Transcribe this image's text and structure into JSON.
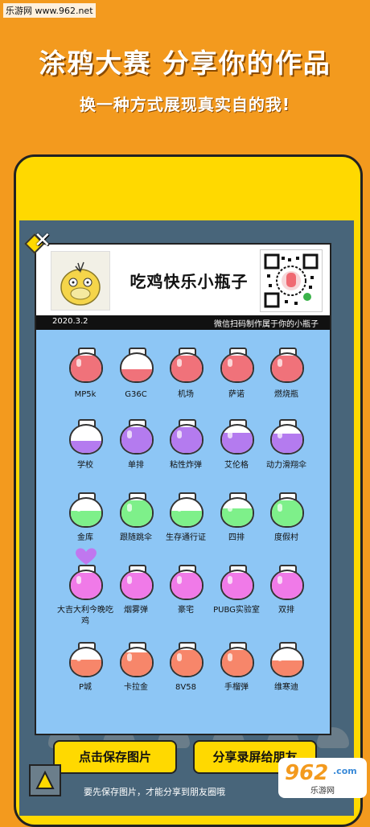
{
  "watermark_top": "乐游网 www.962.net",
  "headline": "涂鸦大赛 分享你的作品",
  "subline": "换一种方式展现真实自的我!",
  "card": {
    "title": "吃鸡快乐小瓶子",
    "date": "2020.3.2",
    "tagline": "微信扫码制作属于你的小瓶子"
  },
  "bottles": [
    {
      "label": "MP5k",
      "color": "#f0727a",
      "fill": 0.95
    },
    {
      "label": "G36C",
      "color": "#f0727a",
      "fill": 0.45
    },
    {
      "label": "机场",
      "color": "#f0727a",
      "fill": 0.95
    },
    {
      "label": "萨诺",
      "color": "#f0727a",
      "fill": 0.95
    },
    {
      "label": "燃烧瓶",
      "color": "#f0727a",
      "fill": 0.95
    },
    {
      "label": "学校",
      "color": "#b47bef",
      "fill": 0.45
    },
    {
      "label": "单排",
      "color": "#b47bef",
      "fill": 0.95
    },
    {
      "label": "粘性炸弹",
      "color": "#b47bef",
      "fill": 0.95
    },
    {
      "label": "艾伦格",
      "color": "#b47bef",
      "fill": 0.75
    },
    {
      "label": "动力滑翔伞",
      "color": "#b47bef",
      "fill": 0.7
    },
    {
      "label": "金库",
      "color": "#7ef08a",
      "fill": 0.55
    },
    {
      "label": "跟随跳伞",
      "color": "#7ef08a",
      "fill": 0.95
    },
    {
      "label": "生存通行证",
      "color": "#7ef08a",
      "fill": 0.55
    },
    {
      "label": "四排",
      "color": "#7ef08a",
      "fill": 0.65
    },
    {
      "label": "度假村",
      "color": "#7ef08a",
      "fill": 0.95
    },
    {
      "label": "大吉大利今晚吃鸡",
      "color": "#f07ae8",
      "fill": 0.95
    },
    {
      "label": "烟雾弹",
      "color": "#f07ae8",
      "fill": 0.95
    },
    {
      "label": "豪宅",
      "color": "#f07ae8",
      "fill": 0.95
    },
    {
      "label": "PUBG实验室",
      "color": "#f07ae8",
      "fill": 0.95
    },
    {
      "label": "双排",
      "color": "#f07ae8",
      "fill": 0.95
    },
    {
      "label": "P城",
      "color": "#f7866a",
      "fill": 0.6
    },
    {
      "label": "卡拉金",
      "color": "#f7866a",
      "fill": 0.85
    },
    {
      "label": "8V58",
      "color": "#f7866a",
      "fill": 0.95
    },
    {
      "label": "手榴弹",
      "color": "#f7866a",
      "fill": 0.95
    },
    {
      "label": "维寒迪",
      "color": "#f7866a",
      "fill": 0.55
    }
  ],
  "buttons": {
    "save": "点击保存图片",
    "share": "分享录屏给朋友"
  },
  "bottom_note": "要先保存图片，才能分享到朋友圈哦",
  "watermark_br": {
    "big": "962",
    "com": ".com",
    "small": "乐游网"
  },
  "icons": {
    "close": "close-icon",
    "diamond": "diamond-icon",
    "heart": "heart-icon",
    "qr": "qr-code-icon",
    "avatar": "duck-avatar-icon"
  }
}
